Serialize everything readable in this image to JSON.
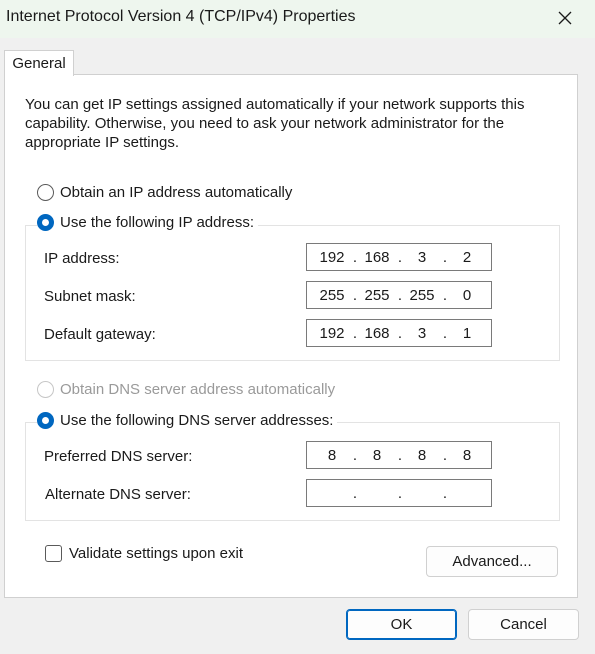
{
  "window": {
    "title": "Internet Protocol Version 4 (TCP/IPv4) Properties",
    "close_glyph": "✕"
  },
  "tabs": [
    {
      "label": "General",
      "selected": true
    }
  ],
  "general": {
    "description": "You can get IP settings assigned automatically if your network supports this capability. Otherwise, you need to ask your network administrator for the appropriate IP settings.",
    "ip_mode": {
      "auto_label": "Obtain an IP address automatically",
      "manual_label": "Use the following IP address:",
      "selected": "manual"
    },
    "ip_fields": {
      "ip_address": {
        "label": "IP address:",
        "octets": [
          "192",
          "168",
          "3",
          "2"
        ]
      },
      "subnet_mask": {
        "label": "Subnet mask:",
        "octets": [
          "255",
          "255",
          "255",
          "0"
        ]
      },
      "default_gateway": {
        "label": "Default gateway:",
        "octets": [
          "192",
          "168",
          "3",
          "1"
        ]
      }
    },
    "dns_mode": {
      "auto_label": "Obtain DNS server address automatically",
      "manual_label": "Use the following DNS server addresses:",
      "selected": "manual",
      "auto_disabled": true
    },
    "dns_fields": {
      "preferred": {
        "label": "Preferred DNS server:",
        "octets": [
          "8",
          "8",
          "8",
          "8"
        ]
      },
      "alternate": {
        "label": "Alternate DNS server:",
        "octets": [
          "",
          "",
          "",
          ""
        ]
      }
    },
    "validate_label": "Validate settings upon exit",
    "validate_checked": false,
    "advanced_label": "Advanced..."
  },
  "buttons": {
    "ok": "OK",
    "cancel": "Cancel"
  },
  "colors": {
    "accent": "#0067c0",
    "titlebar_bg": "#eef6ee",
    "dialog_bg": "#f0f0f0",
    "panel_bg": "#ffffff"
  }
}
